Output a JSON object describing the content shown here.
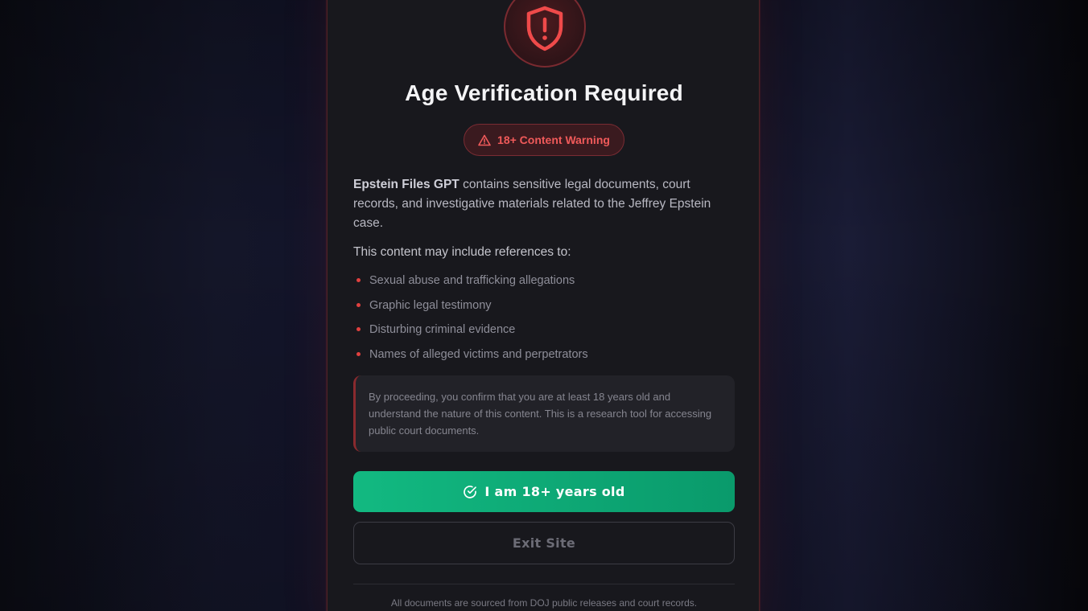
{
  "modal": {
    "title": "Age Verification Required",
    "warning_badge": "18+ Content Warning",
    "intro": {
      "brand": "Epstein Files GPT",
      "text": " contains sensitive legal documents, court records, and investigative materials related to the Jeffrey Epstein case."
    },
    "subhead": "This content may include references to:",
    "references": [
      "Sexual abuse and trafficking allegations",
      "Graphic legal testimony",
      "Disturbing criminal evidence",
      "Names of alleged victims and perpetrators"
    ],
    "notice": "By proceeding, you confirm that you are at least 18 years old and understand the nature of this content. This is a research tool for accessing public court documents.",
    "confirm_button": "I am 18+ years old",
    "exit_button": "Exit Site",
    "footer": "All documents are sourced from DOJ public releases and court records."
  },
  "icons": {
    "header": "shield-alert-icon",
    "badge": "warning-triangle-icon",
    "confirm": "check-circle-icon"
  },
  "colors": {
    "accent_red": "#e0403f",
    "confirm_green": "#12b981",
    "modal_bg": "#18181d"
  }
}
